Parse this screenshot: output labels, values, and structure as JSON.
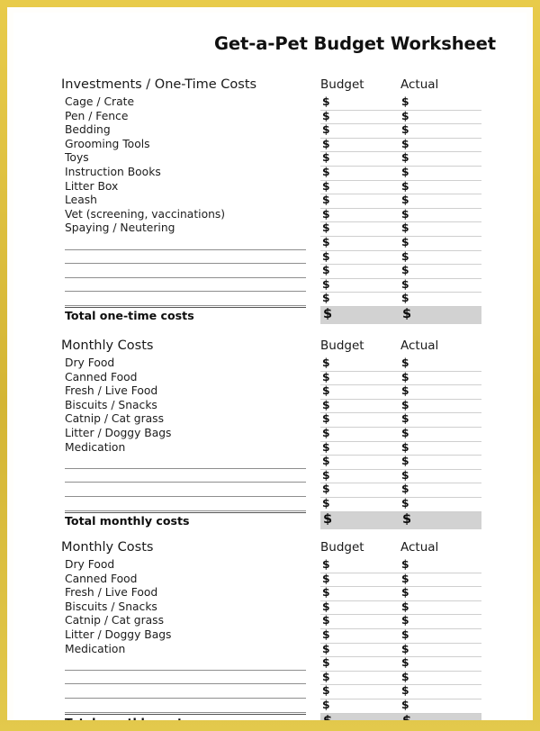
{
  "document": {
    "title": "Get-a-Pet Budget Worksheet",
    "accent_border_color": "#d9bd3f",
    "page_background_color": "#ffffff",
    "total_row_background_color": "#d2d2d2",
    "currency_symbol": "$"
  },
  "columns": {
    "budget_label": "Budget",
    "actual_label": "Actual"
  },
  "sections": [
    {
      "heading": "Investments / One-Time Costs",
      "items": [
        "Cage / Crate",
        "Pen / Fence",
        "Bedding",
        "Grooming Tools",
        "Toys",
        "Instruction Books",
        "Litter Box",
        "Leash",
        "Vet (screening, vaccinations)",
        "Spaying / Neutering"
      ],
      "blank_line_count": 5,
      "total_label": "Total one-time costs"
    },
    {
      "heading": "Monthly Costs",
      "items": [
        "Dry Food",
        "Canned Food",
        "Fresh / Live Food",
        "Biscuits / Snacks",
        "Catnip / Cat grass",
        "Litter / Doggy Bags",
        "Medication"
      ],
      "blank_line_count": 4,
      "total_label": "Total monthly costs"
    },
    {
      "heading": "Monthly Costs",
      "items": [
        "Dry Food",
        "Canned Food",
        "Fresh / Live Food",
        "Biscuits / Snacks",
        "Catnip / Cat grass",
        "Litter / Doggy Bags",
        "Medication"
      ],
      "blank_line_count": 4,
      "total_label": "Total monthly costs"
    }
  ]
}
